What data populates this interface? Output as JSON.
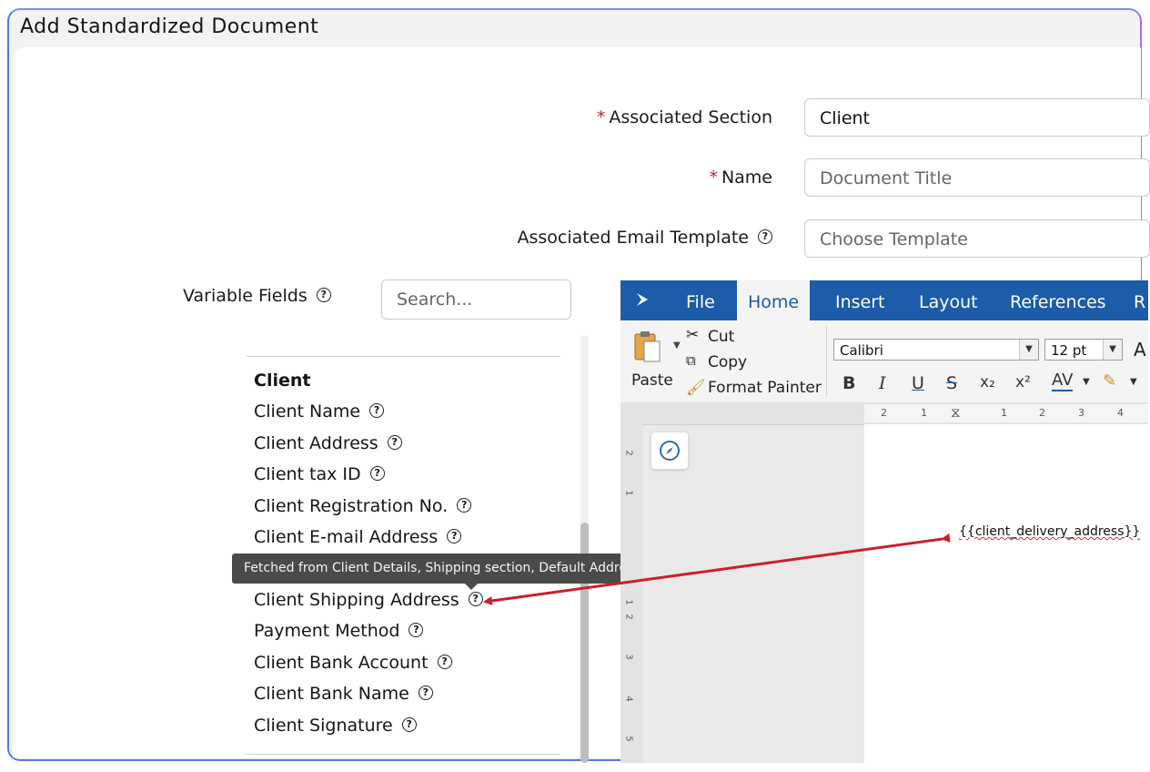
{
  "title": "Add Standardized Document",
  "form": {
    "associated_section": {
      "label": "Associated Section",
      "value": "Client"
    },
    "name": {
      "label": "Name",
      "placeholder": "Document Title"
    },
    "email_template": {
      "label": "Associated Email Template",
      "placeholder": "Choose Template"
    },
    "required_mark": "*"
  },
  "variable_fields": {
    "label": "Variable Fields",
    "search_placeholder": "Search...",
    "group_title": "Client",
    "items": [
      "Client Name",
      "Client Address",
      "Client tax ID",
      "Client Registration No.",
      "Client E-mail Address",
      "Client Shipping Address",
      "Payment Method",
      "Client Bank Account",
      "Client Bank Name",
      "Client Signature"
    ],
    "help_glyph": "?"
  },
  "tooltip": "Fetched from Client Details, Shipping section, Default Address field",
  "editor": {
    "tabs": [
      "File",
      "Home",
      "Insert",
      "Layout",
      "References",
      "R"
    ],
    "active_tab": "Home",
    "clipboard": {
      "paste": "Paste",
      "cut": "Cut",
      "copy": "Copy",
      "format_painter": "Format Painter"
    },
    "font_name": "Calibri",
    "font_size": "12 pt",
    "font_grow_glyph": "A",
    "format_buttons": [
      "B",
      "I",
      "U",
      "S",
      "x₂",
      "x²",
      "AV"
    ],
    "ruler_marks": [
      "2",
      "1",
      "1",
      "2",
      "3",
      "4"
    ],
    "vruler_marks": [
      "2",
      "1",
      "1",
      "2",
      "3",
      "4",
      "5"
    ],
    "placeholder_text": "{{client_delivery_address}}"
  },
  "colors": {
    "accent": "#1c5ca8",
    "required": "#c02035",
    "arrow": "#c8202c",
    "tooltip_bg": "#4a4a4a"
  }
}
